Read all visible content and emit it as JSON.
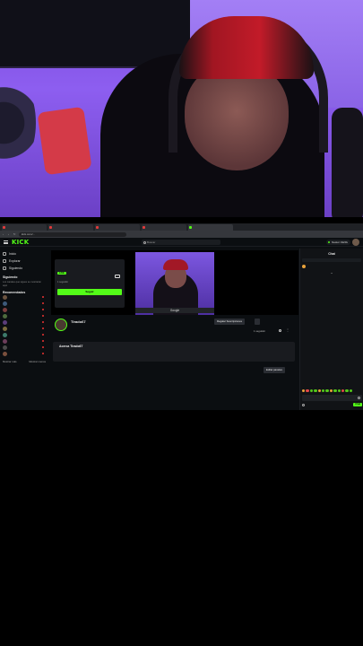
{
  "browser": {
    "tabs": [
      "",
      "",
      "",
      "",
      "",
      ""
    ],
    "url": "kick.com/..."
  },
  "header": {
    "logo": "KICK",
    "search_placeholder": "Buscar",
    "user": "Nestor 1920x"
  },
  "sidebar": {
    "items": [
      {
        "label": "Inicio",
        "icon": "home-icon"
      },
      {
        "label": "Explorar",
        "icon": "compass-icon"
      },
      {
        "label": "Siguiendo",
        "icon": "heart-icon"
      }
    ],
    "following_title": "Siguiendo",
    "following_note": "Los canales que sigues se mostrarán aquí",
    "recommended_title": "Recomendados",
    "recommended": [
      {
        "name": "",
        "category": "",
        "viewers": ""
      },
      {
        "name": "",
        "category": "",
        "viewers": ""
      },
      {
        "name": "",
        "category": "",
        "viewers": ""
      },
      {
        "name": "",
        "category": "",
        "viewers": ""
      },
      {
        "name": "",
        "category": "",
        "viewers": ""
      },
      {
        "name": "",
        "category": "",
        "viewers": ""
      },
      {
        "name": "",
        "category": "",
        "viewers": ""
      },
      {
        "name": "",
        "category": "",
        "viewers": ""
      },
      {
        "name": "",
        "category": "",
        "viewers": ""
      },
      {
        "name": "",
        "category": "",
        "viewers": ""
      }
    ],
    "show_more": "Mostrar más",
    "show_less": "Mostrar menos"
  },
  "player": {
    "live_badge": "LIVE",
    "offline_title": "",
    "followers_text": "1 seguidor",
    "follow_button": "Seguir",
    "caption": "Google"
  },
  "channel": {
    "name": "Tirado67",
    "subtitle": "",
    "meta": "",
    "tag": "",
    "subscribe_button": "Regalar Suscripciones",
    "rename_button": "",
    "follower_count": "1 seguidor",
    "about_title": "Acerca Tirado67",
    "verified": "",
    "about_text": "",
    "edit_link": "",
    "panels_button": "Editar paneles"
  },
  "chat": {
    "title": "Chat",
    "pinned": "",
    "message_user": "",
    "message_text": "",
    "emote_label": "",
    "input_placeholder": "",
    "send_label": "Chat"
  }
}
